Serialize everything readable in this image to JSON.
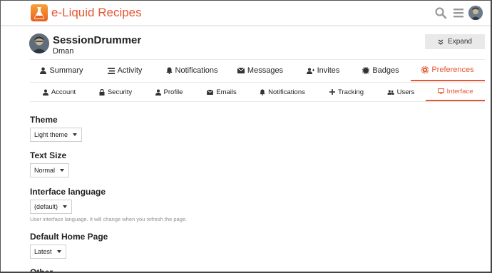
{
  "header": {
    "site_title": "e-Liquid Recipes",
    "brand_color": "#e45735",
    "icons": [
      "search-icon",
      "hamburger-menu-icon",
      "user-avatar"
    ]
  },
  "user": {
    "username": "SessionDrummer",
    "name": "Dman",
    "expand_label": "Expand"
  },
  "nav_primary": [
    {
      "label": "Summary",
      "icon": "user-icon"
    },
    {
      "label": "Activity",
      "icon": "stream-icon"
    },
    {
      "label": "Notifications",
      "icon": "bell-icon"
    },
    {
      "label": "Messages",
      "icon": "envelope-icon"
    },
    {
      "label": "Invites",
      "icon": "user-plus-icon"
    },
    {
      "label": "Badges",
      "icon": "certificate-icon"
    },
    {
      "label": "Preferences",
      "icon": "cog-icon",
      "active": true
    }
  ],
  "nav_secondary": [
    {
      "label": "Account",
      "icon": "user-icon"
    },
    {
      "label": "Security",
      "icon": "lock-icon"
    },
    {
      "label": "Profile",
      "icon": "user-icon"
    },
    {
      "label": "Emails",
      "icon": "envelope-icon"
    },
    {
      "label": "Notifications",
      "icon": "bell-icon"
    },
    {
      "label": "Tracking",
      "icon": "plus-icon"
    },
    {
      "label": "Users",
      "icon": "users-icon"
    },
    {
      "label": "Interface",
      "icon": "desktop-icon",
      "active": true
    }
  ],
  "preferences": {
    "theme": {
      "label": "Theme",
      "value": "Light theme"
    },
    "text_size": {
      "label": "Text Size",
      "value": "Normal"
    },
    "interface_language": {
      "label": "Interface language",
      "value": "(default)",
      "help": "User interface language. It will change when you refresh the page."
    },
    "default_home_page": {
      "label": "Default Home Page",
      "value": "Latest"
    },
    "other": {
      "label": "Other"
    }
  }
}
